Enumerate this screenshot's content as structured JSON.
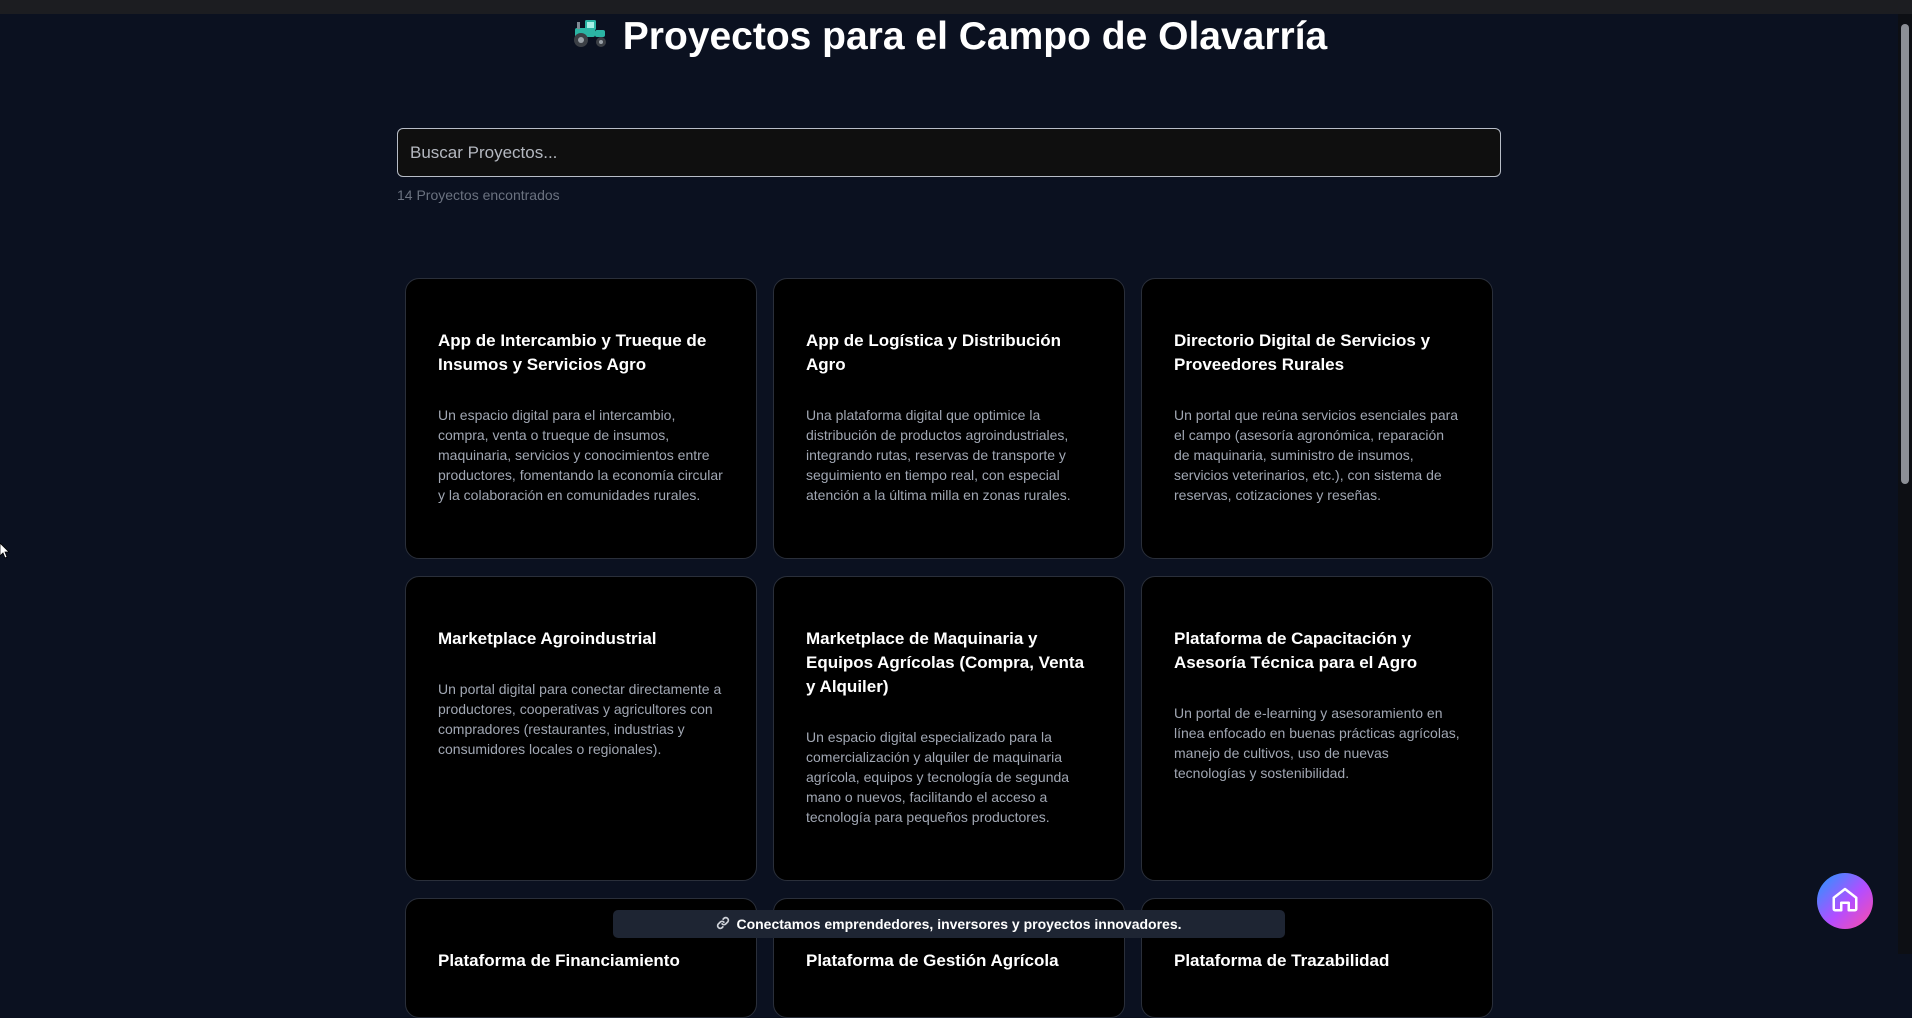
{
  "page": {
    "title": "Proyectos para el Campo de Olavarría",
    "title_icon": "tractor-icon"
  },
  "search": {
    "placeholder": "Buscar Proyectos...",
    "value": "",
    "count_text": "14 Proyectos encontrados"
  },
  "projects": [
    {
      "title": "App de Intercambio y Trueque de Insumos y Servicios Agro",
      "description": "Un espacio digital para el intercambio, compra, venta o trueque de insumos, maquinaria, servicios y conocimientos entre productores, fomentando la economía circular y la colaboración en comunidades rurales."
    },
    {
      "title": "App de Logística y Distribución Agro",
      "description": "Una plataforma digital que optimice la distribución de productos agroindustriales, integrando rutas, reservas de transporte y seguimiento en tiempo real, con especial atención a la última milla en zonas rurales."
    },
    {
      "title": "Directorio Digital de Servicios y Proveedores Rurales",
      "description": "Un portal que reúna servicios esenciales para el campo (asesoría agronómica, reparación de maquinaria, suministro de insumos, servicios veterinarios, etc.), con sistema de reservas, cotizaciones y reseñas."
    },
    {
      "title": "Marketplace Agroindustrial",
      "description": "Un portal digital para conectar directamente a productores, cooperativas y agricultores con compradores (restaurantes, industrias y consumidores locales o regionales)."
    },
    {
      "title": "Marketplace de Maquinaria y Equipos Agrícolas (Compra, Venta y Alquiler)",
      "description": "Un espacio digital especializado para la comercialización y alquiler de maquinaria agrícola, equipos y tecnología de segunda mano o nuevos, facilitando el acceso a tecnología para pequeños productores."
    },
    {
      "title": "Plataforma de Capacitación y Asesoría Técnica para el Agro",
      "description": "Un portal de e-learning y asesoramiento en línea enfocado en buenas prácticas agrícolas, manejo de cultivos, uso de nuevas tecnologías y sostenibilidad."
    }
  ],
  "partial_row_titles": [
    "Plataforma de Financiamiento",
    "Plataforma de Gestión Agrícola",
    "Plataforma de Trazabilidad"
  ],
  "banner": {
    "icon": "link-icon",
    "text": "Conectamos emprendedores, inversores y proyectos innovadores."
  },
  "home_button": {
    "icon": "home-icon"
  },
  "colors": {
    "background": "#0b1120",
    "card": "#000000",
    "card_border": "#2a2f3a",
    "muted_text": "#a1a7b3"
  }
}
